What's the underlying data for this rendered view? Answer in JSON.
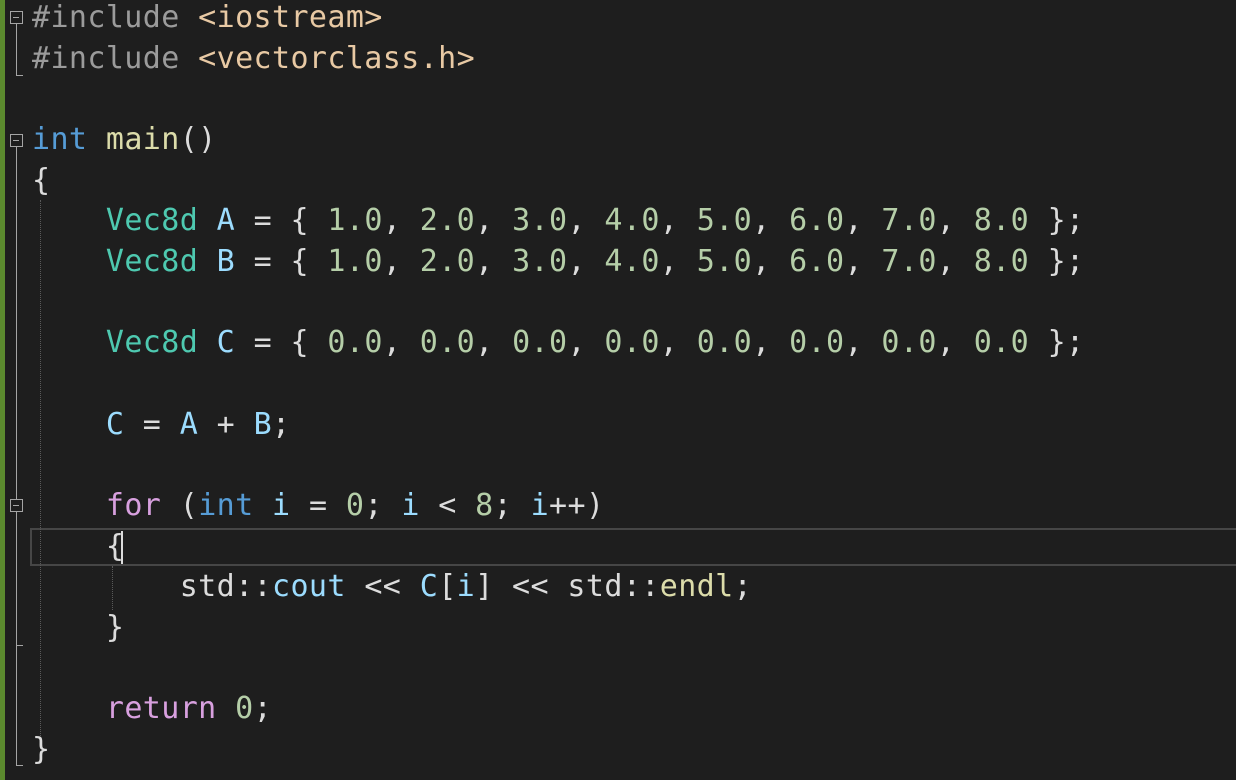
{
  "editor": {
    "language": "cpp",
    "caret_line": 14,
    "lines": [
      [
        {
          "t": "pre",
          "v": "#include "
        },
        {
          "t": "inc",
          "v": "<iostream>"
        }
      ],
      [
        {
          "t": "pre",
          "v": "#include "
        },
        {
          "t": "inc",
          "v": "<vectorclass.h>"
        }
      ],
      [],
      [
        {
          "t": "kw",
          "v": "int"
        },
        {
          "t": "p",
          "v": " "
        },
        {
          "t": "fn",
          "v": "main"
        },
        {
          "t": "p",
          "v": "()"
        }
      ],
      [
        {
          "t": "p",
          "v": "{"
        }
      ],
      [
        {
          "t": "p",
          "v": "    "
        },
        {
          "t": "type",
          "v": "Vec8d"
        },
        {
          "t": "p",
          "v": " "
        },
        {
          "t": "var",
          "v": "A"
        },
        {
          "t": "p",
          "v": " = { "
        },
        {
          "t": "num",
          "v": "1.0"
        },
        {
          "t": "p",
          "v": ", "
        },
        {
          "t": "num",
          "v": "2.0"
        },
        {
          "t": "p",
          "v": ", "
        },
        {
          "t": "num",
          "v": "3.0"
        },
        {
          "t": "p",
          "v": ", "
        },
        {
          "t": "num",
          "v": "4.0"
        },
        {
          "t": "p",
          "v": ", "
        },
        {
          "t": "num",
          "v": "5.0"
        },
        {
          "t": "p",
          "v": ", "
        },
        {
          "t": "num",
          "v": "6.0"
        },
        {
          "t": "p",
          "v": ", "
        },
        {
          "t": "num",
          "v": "7.0"
        },
        {
          "t": "p",
          "v": ", "
        },
        {
          "t": "num",
          "v": "8.0"
        },
        {
          "t": "p",
          "v": " };"
        }
      ],
      [
        {
          "t": "p",
          "v": "    "
        },
        {
          "t": "type",
          "v": "Vec8d"
        },
        {
          "t": "p",
          "v": " "
        },
        {
          "t": "var",
          "v": "B"
        },
        {
          "t": "p",
          "v": " = { "
        },
        {
          "t": "num",
          "v": "1.0"
        },
        {
          "t": "p",
          "v": ", "
        },
        {
          "t": "num",
          "v": "2.0"
        },
        {
          "t": "p",
          "v": ", "
        },
        {
          "t": "num",
          "v": "3.0"
        },
        {
          "t": "p",
          "v": ", "
        },
        {
          "t": "num",
          "v": "4.0"
        },
        {
          "t": "p",
          "v": ", "
        },
        {
          "t": "num",
          "v": "5.0"
        },
        {
          "t": "p",
          "v": ", "
        },
        {
          "t": "num",
          "v": "6.0"
        },
        {
          "t": "p",
          "v": ", "
        },
        {
          "t": "num",
          "v": "7.0"
        },
        {
          "t": "p",
          "v": ", "
        },
        {
          "t": "num",
          "v": "8.0"
        },
        {
          "t": "p",
          "v": " };"
        }
      ],
      [],
      [
        {
          "t": "p",
          "v": "    "
        },
        {
          "t": "type",
          "v": "Vec8d"
        },
        {
          "t": "p",
          "v": " "
        },
        {
          "t": "var",
          "v": "C"
        },
        {
          "t": "p",
          "v": " = { "
        },
        {
          "t": "num",
          "v": "0.0"
        },
        {
          "t": "p",
          "v": ", "
        },
        {
          "t": "num",
          "v": "0.0"
        },
        {
          "t": "p",
          "v": ", "
        },
        {
          "t": "num",
          "v": "0.0"
        },
        {
          "t": "p",
          "v": ", "
        },
        {
          "t": "num",
          "v": "0.0"
        },
        {
          "t": "p",
          "v": ", "
        },
        {
          "t": "num",
          "v": "0.0"
        },
        {
          "t": "p",
          "v": ", "
        },
        {
          "t": "num",
          "v": "0.0"
        },
        {
          "t": "p",
          "v": ", "
        },
        {
          "t": "num",
          "v": "0.0"
        },
        {
          "t": "p",
          "v": ", "
        },
        {
          "t": "num",
          "v": "0.0"
        },
        {
          "t": "p",
          "v": " };"
        }
      ],
      [],
      [
        {
          "t": "p",
          "v": "    "
        },
        {
          "t": "var",
          "v": "C"
        },
        {
          "t": "p",
          "v": " = "
        },
        {
          "t": "var",
          "v": "A"
        },
        {
          "t": "p",
          "v": " + "
        },
        {
          "t": "var",
          "v": "B"
        },
        {
          "t": "p",
          "v": ";"
        }
      ],
      [],
      [
        {
          "t": "p",
          "v": "    "
        },
        {
          "t": "ctl",
          "v": "for"
        },
        {
          "t": "p",
          "v": " ("
        },
        {
          "t": "kw",
          "v": "int"
        },
        {
          "t": "p",
          "v": " "
        },
        {
          "t": "var",
          "v": "i"
        },
        {
          "t": "p",
          "v": " = "
        },
        {
          "t": "num",
          "v": "0"
        },
        {
          "t": "p",
          "v": "; "
        },
        {
          "t": "var",
          "v": "i"
        },
        {
          "t": "p",
          "v": " < "
        },
        {
          "t": "num",
          "v": "8"
        },
        {
          "t": "p",
          "v": "; "
        },
        {
          "t": "var",
          "v": "i"
        },
        {
          "t": "p",
          "v": "++)"
        }
      ],
      [
        {
          "t": "p",
          "v": "    {"
        }
      ],
      [
        {
          "t": "p",
          "v": "        std::"
        },
        {
          "t": "var",
          "v": "cout"
        },
        {
          "t": "p",
          "v": " << "
        },
        {
          "t": "var",
          "v": "C"
        },
        {
          "t": "p",
          "v": "["
        },
        {
          "t": "var",
          "v": "i"
        },
        {
          "t": "p",
          "v": "] << std::"
        },
        {
          "t": "fn",
          "v": "endl"
        },
        {
          "t": "p",
          "v": ";"
        }
      ],
      [
        {
          "t": "p",
          "v": "    }"
        }
      ],
      [],
      [
        {
          "t": "p",
          "v": "    "
        },
        {
          "t": "ctl",
          "v": "return"
        },
        {
          "t": "p",
          "v": " "
        },
        {
          "t": "num",
          "v": "0"
        },
        {
          "t": "p",
          "v": ";"
        }
      ],
      [
        {
          "t": "p",
          "v": "}"
        }
      ]
    ]
  }
}
